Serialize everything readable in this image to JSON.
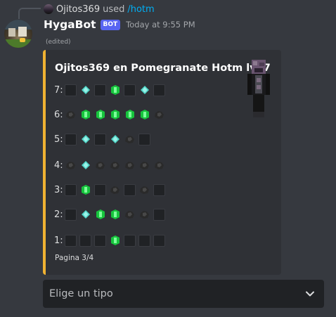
{
  "reply": {
    "username": "Ojitos369",
    "used_text": "used",
    "command": "/hotm"
  },
  "message": {
    "author": "HygaBot",
    "bot_tag": "BOT",
    "timestamp": "Today at 9:55 PM",
    "edited": "(edited)"
  },
  "embed": {
    "accent_color": "#f0b232",
    "title": "Ojitos369 en Pomegranate Hotm lvl 7",
    "rows": [
      {
        "label": "7:",
        "slots": [
          "empty",
          "diamond",
          "empty",
          "emerald",
          "empty",
          "diamond",
          "empty"
        ]
      },
      {
        "label": "6:",
        "slots": [
          "coal",
          "emerald",
          "emerald",
          "emerald",
          "emerald",
          "emerald",
          "coal"
        ]
      },
      {
        "label": "5:",
        "slots": [
          "empty",
          "diamond",
          "empty",
          "diamond",
          "coal",
          "empty"
        ]
      },
      {
        "label": "4:",
        "slots": [
          "coal",
          "diamond",
          "coal",
          "coal",
          "coal",
          "coal",
          "coal"
        ]
      },
      {
        "label": "3:",
        "slots": [
          "empty",
          "emerald",
          "empty",
          "coal",
          "empty",
          "coal",
          "empty"
        ]
      },
      {
        "label": "2:",
        "slots": [
          "empty",
          "diamond",
          "emerald",
          "emerald",
          "coal",
          "coal",
          "empty"
        ]
      },
      {
        "label": "1:",
        "slots": [
          "empty",
          "empty",
          "empty",
          "emerald",
          "empty",
          "empty",
          "empty"
        ]
      }
    ],
    "footer": "Pagina 3/4"
  },
  "select": {
    "placeholder": "Elige un tipo"
  }
}
